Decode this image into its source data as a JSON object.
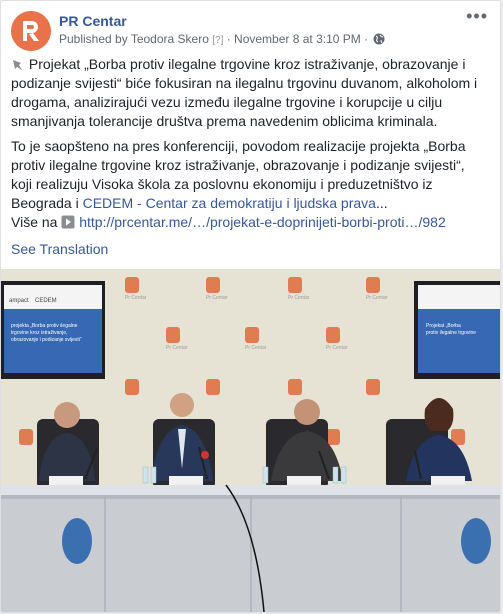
{
  "post": {
    "page_name": "PR Centar",
    "published_by": "Published by Teodora Skero",
    "question_badge": "[?]",
    "separator": "·",
    "timestamp": "November 8 at 3:10 PM",
    "separator2": "·",
    "more_label": "•••",
    "paragraph1": "Projekat „Borba protiv ilegalne trgovine kroz istraživanje, obrazovanje i podizanje svijesti“ biće fokusiran na ilegalnu trgovinu duvanom, alkoholom i drogama, analizirajući vezu između ilegalne trgovine i korupcije u cilju smanjivanja tolerancije društva prema navedenim oblicima kriminala.",
    "paragraph2_start": "To je saopšteno na pres konferenciji, povodom realizacije projekta „Borba protiv ilegalne trgovine kroz istraživanje, obrazovanje i podizanje svijesti“, koji realizuju Visoka škola za poslovnu ekonomiju i preduzetništvo iz Beograda i ",
    "paragraph2_link": "CEDEM - Centar za demokratiju i ljudska prava",
    "paragraph2_end": "...",
    "more_prefix": "Više na ",
    "url": "http://prcentar.me/…/projekat-e-doprinijeti-borbi-proti…/982",
    "see_translation": "See Translation"
  },
  "photo": {
    "backdrop_logo_text": "Pr Centar",
    "slide_text": "Projekat „Borba protiv ilegalne trgovine kroz istraživanje, obrazovanje i podizanje svijesti“"
  }
}
